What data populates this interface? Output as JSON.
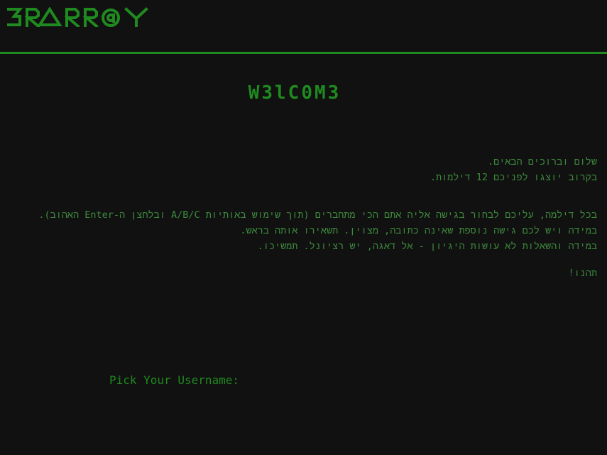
{
  "header": {
    "logo_text": "3RARR@Y"
  },
  "main": {
    "title": "W3lC0M3",
    "intro_block1": [
      "שלום וברוכים הבאים.",
      "בקרוב יוצגו לפניכם 12 דילמות."
    ],
    "intro_block2": [
      "בכל דילמה, עליכם לבחור בגישה אליה אתם הכי מתחברים (תוך שימוש באותיות A/B/C ובלחצן ה-Enter האהוב).",
      "במידה ויש לכם גישה נוספת שאינה כתובה, מצוין. תשאירו אותה בראש.",
      "במידה והשאלות לא עושות היגיון - אל דאגה, יש רציונל. תמשיכו."
    ],
    "intro_block3": [
      "תהנו!"
    ],
    "username_label": "Pick Your Username:"
  },
  "colors": {
    "background": "#111111",
    "accent": "#1f8a1f",
    "text": "#3e8a3e"
  }
}
